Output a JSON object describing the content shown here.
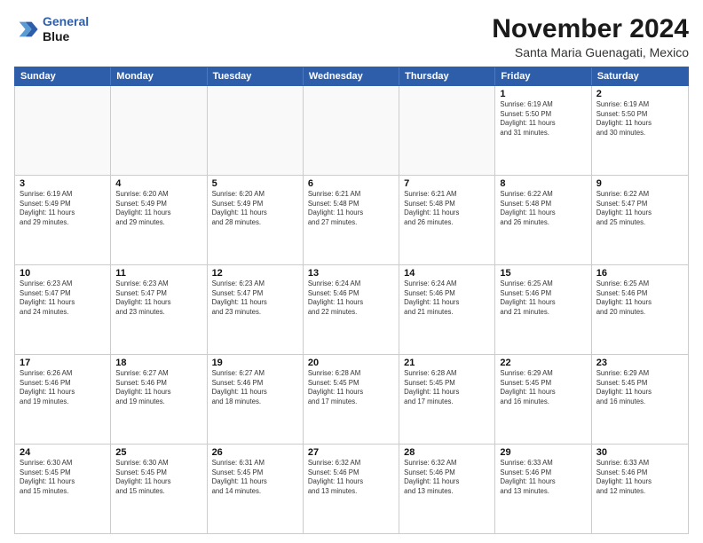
{
  "logo": {
    "line1": "General",
    "line2": "Blue"
  },
  "title": "November 2024",
  "subtitle": "Santa Maria Guenagati, Mexico",
  "days_of_week": [
    "Sunday",
    "Monday",
    "Tuesday",
    "Wednesday",
    "Thursday",
    "Friday",
    "Saturday"
  ],
  "weeks": [
    [
      {
        "day": "",
        "info": "",
        "empty": true
      },
      {
        "day": "",
        "info": "",
        "empty": true
      },
      {
        "day": "",
        "info": "",
        "empty": true
      },
      {
        "day": "",
        "info": "",
        "empty": true
      },
      {
        "day": "",
        "info": "",
        "empty": true
      },
      {
        "day": "1",
        "info": "Sunrise: 6:19 AM\nSunset: 5:50 PM\nDaylight: 11 hours\nand 31 minutes.",
        "empty": false
      },
      {
        "day": "2",
        "info": "Sunrise: 6:19 AM\nSunset: 5:50 PM\nDaylight: 11 hours\nand 30 minutes.",
        "empty": false
      }
    ],
    [
      {
        "day": "3",
        "info": "Sunrise: 6:19 AM\nSunset: 5:49 PM\nDaylight: 11 hours\nand 29 minutes.",
        "empty": false
      },
      {
        "day": "4",
        "info": "Sunrise: 6:20 AM\nSunset: 5:49 PM\nDaylight: 11 hours\nand 29 minutes.",
        "empty": false
      },
      {
        "day": "5",
        "info": "Sunrise: 6:20 AM\nSunset: 5:49 PM\nDaylight: 11 hours\nand 28 minutes.",
        "empty": false
      },
      {
        "day": "6",
        "info": "Sunrise: 6:21 AM\nSunset: 5:48 PM\nDaylight: 11 hours\nand 27 minutes.",
        "empty": false
      },
      {
        "day": "7",
        "info": "Sunrise: 6:21 AM\nSunset: 5:48 PM\nDaylight: 11 hours\nand 26 minutes.",
        "empty": false
      },
      {
        "day": "8",
        "info": "Sunrise: 6:22 AM\nSunset: 5:48 PM\nDaylight: 11 hours\nand 26 minutes.",
        "empty": false
      },
      {
        "day": "9",
        "info": "Sunrise: 6:22 AM\nSunset: 5:47 PM\nDaylight: 11 hours\nand 25 minutes.",
        "empty": false
      }
    ],
    [
      {
        "day": "10",
        "info": "Sunrise: 6:23 AM\nSunset: 5:47 PM\nDaylight: 11 hours\nand 24 minutes.",
        "empty": false
      },
      {
        "day": "11",
        "info": "Sunrise: 6:23 AM\nSunset: 5:47 PM\nDaylight: 11 hours\nand 23 minutes.",
        "empty": false
      },
      {
        "day": "12",
        "info": "Sunrise: 6:23 AM\nSunset: 5:47 PM\nDaylight: 11 hours\nand 23 minutes.",
        "empty": false
      },
      {
        "day": "13",
        "info": "Sunrise: 6:24 AM\nSunset: 5:46 PM\nDaylight: 11 hours\nand 22 minutes.",
        "empty": false
      },
      {
        "day": "14",
        "info": "Sunrise: 6:24 AM\nSunset: 5:46 PM\nDaylight: 11 hours\nand 21 minutes.",
        "empty": false
      },
      {
        "day": "15",
        "info": "Sunrise: 6:25 AM\nSunset: 5:46 PM\nDaylight: 11 hours\nand 21 minutes.",
        "empty": false
      },
      {
        "day": "16",
        "info": "Sunrise: 6:25 AM\nSunset: 5:46 PM\nDaylight: 11 hours\nand 20 minutes.",
        "empty": false
      }
    ],
    [
      {
        "day": "17",
        "info": "Sunrise: 6:26 AM\nSunset: 5:46 PM\nDaylight: 11 hours\nand 19 minutes.",
        "empty": false
      },
      {
        "day": "18",
        "info": "Sunrise: 6:27 AM\nSunset: 5:46 PM\nDaylight: 11 hours\nand 19 minutes.",
        "empty": false
      },
      {
        "day": "19",
        "info": "Sunrise: 6:27 AM\nSunset: 5:46 PM\nDaylight: 11 hours\nand 18 minutes.",
        "empty": false
      },
      {
        "day": "20",
        "info": "Sunrise: 6:28 AM\nSunset: 5:45 PM\nDaylight: 11 hours\nand 17 minutes.",
        "empty": false
      },
      {
        "day": "21",
        "info": "Sunrise: 6:28 AM\nSunset: 5:45 PM\nDaylight: 11 hours\nand 17 minutes.",
        "empty": false
      },
      {
        "day": "22",
        "info": "Sunrise: 6:29 AM\nSunset: 5:45 PM\nDaylight: 11 hours\nand 16 minutes.",
        "empty": false
      },
      {
        "day": "23",
        "info": "Sunrise: 6:29 AM\nSunset: 5:45 PM\nDaylight: 11 hours\nand 16 minutes.",
        "empty": false
      }
    ],
    [
      {
        "day": "24",
        "info": "Sunrise: 6:30 AM\nSunset: 5:45 PM\nDaylight: 11 hours\nand 15 minutes.",
        "empty": false
      },
      {
        "day": "25",
        "info": "Sunrise: 6:30 AM\nSunset: 5:45 PM\nDaylight: 11 hours\nand 15 minutes.",
        "empty": false
      },
      {
        "day": "26",
        "info": "Sunrise: 6:31 AM\nSunset: 5:45 PM\nDaylight: 11 hours\nand 14 minutes.",
        "empty": false
      },
      {
        "day": "27",
        "info": "Sunrise: 6:32 AM\nSunset: 5:46 PM\nDaylight: 11 hours\nand 13 minutes.",
        "empty": false
      },
      {
        "day": "28",
        "info": "Sunrise: 6:32 AM\nSunset: 5:46 PM\nDaylight: 11 hours\nand 13 minutes.",
        "empty": false
      },
      {
        "day": "29",
        "info": "Sunrise: 6:33 AM\nSunset: 5:46 PM\nDaylight: 11 hours\nand 13 minutes.",
        "empty": false
      },
      {
        "day": "30",
        "info": "Sunrise: 6:33 AM\nSunset: 5:46 PM\nDaylight: 11 hours\nand 12 minutes.",
        "empty": false
      }
    ]
  ]
}
